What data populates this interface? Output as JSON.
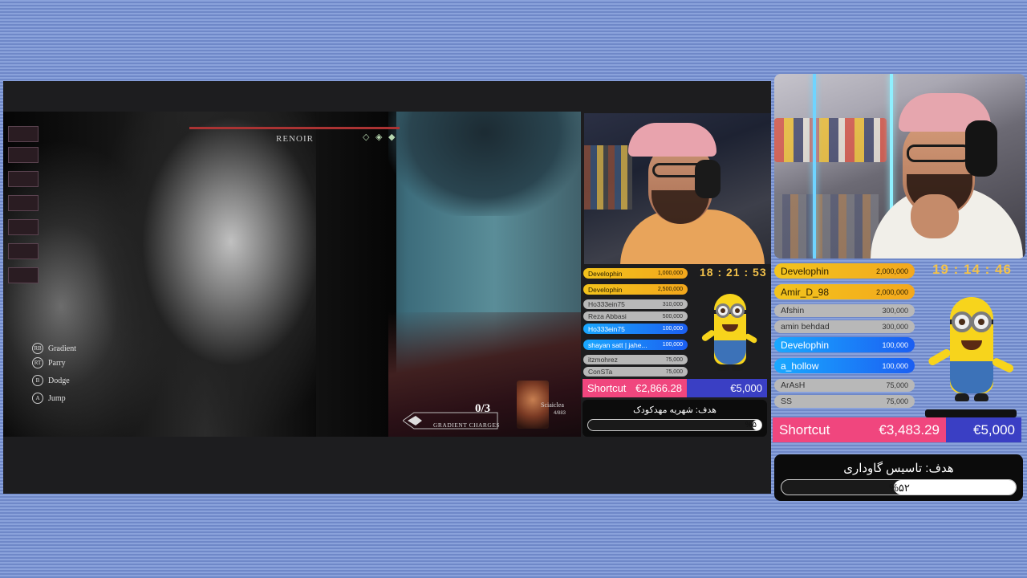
{
  "vod": {
    "boss_name": "RENOIR",
    "controls": [
      {
        "btn": "RB",
        "label": "Gradient"
      },
      {
        "btn": "RT",
        "label": "Parry"
      },
      {
        "btn": "B",
        "label": "Dodge"
      },
      {
        "btn": "A",
        "label": "Jump"
      }
    ],
    "gradient_count": "0/3",
    "gradient_label": "GRADIENT CHARGES",
    "character_name": "Sciaiclea",
    "character_hp": "4/883"
  },
  "inner_overlay": {
    "clock": "18 : 21 : 53",
    "donations": [
      {
        "name": "Develophin",
        "amount": "1,000,000",
        "tier": "gold"
      },
      {
        "name": "Develophin",
        "amount": "2,500,000",
        "tier": "gold"
      },
      {
        "name": "Ho333ein75",
        "amount": "310,000",
        "tier": "gray"
      },
      {
        "name": "Reza Abbasi",
        "amount": "500,000",
        "tier": "gray"
      },
      {
        "name": "Ho333ein75",
        "amount": "100,000",
        "tier": "blue"
      },
      {
        "name": "shayan satt | jahe...",
        "amount": "100,000",
        "tier": "blue"
      },
      {
        "name": "itzmohrez",
        "amount": "75,000",
        "tier": "gray"
      },
      {
        "name": "ConSTa",
        "amount": "75,000",
        "tier": "gray"
      }
    ],
    "shortcut": {
      "label": "Shortcut",
      "current": "€2,866.28",
      "target": "€5,000"
    },
    "goal": {
      "title": "هدف: شهریه مهدکودک",
      "percent_label": "%۵",
      "progress": 0.05
    }
  },
  "outer_overlay": {
    "clock": "19 : 14 : 46",
    "donations": [
      {
        "name": "Develophin",
        "amount": "2,000,000",
        "tier": "gold"
      },
      {
        "name": "Amir_D_98",
        "amount": "2,000,000",
        "tier": "gold"
      },
      {
        "name": "Afshin",
        "amount": "300,000",
        "tier": "gray"
      },
      {
        "name": "amin behdad",
        "amount": "300,000",
        "tier": "gray"
      },
      {
        "name": "Develophin",
        "amount": "100,000",
        "tier": "blue"
      },
      {
        "name": "a_hollow",
        "amount": "100,000",
        "tier": "blue"
      },
      {
        "name": "ArAsH",
        "amount": "75,000",
        "tier": "gray"
      },
      {
        "name": "SS",
        "amount": "75,000",
        "tier": "gray"
      }
    ],
    "shortcut": {
      "label": "Shortcut",
      "current": "€3,483.29",
      "target": "€5,000"
    },
    "goal": {
      "title": "هدف: تاسیس گاوداری",
      "percent_label": "%۵۲",
      "progress": 0.52
    }
  },
  "colors": {
    "background": "#7e96d2",
    "gold": "#f3c31c",
    "blue": "#1b7ef5",
    "shortcut_pink": "#f0467e",
    "shortcut_target": "#3a3fc4",
    "clock": "#f2c14a"
  }
}
